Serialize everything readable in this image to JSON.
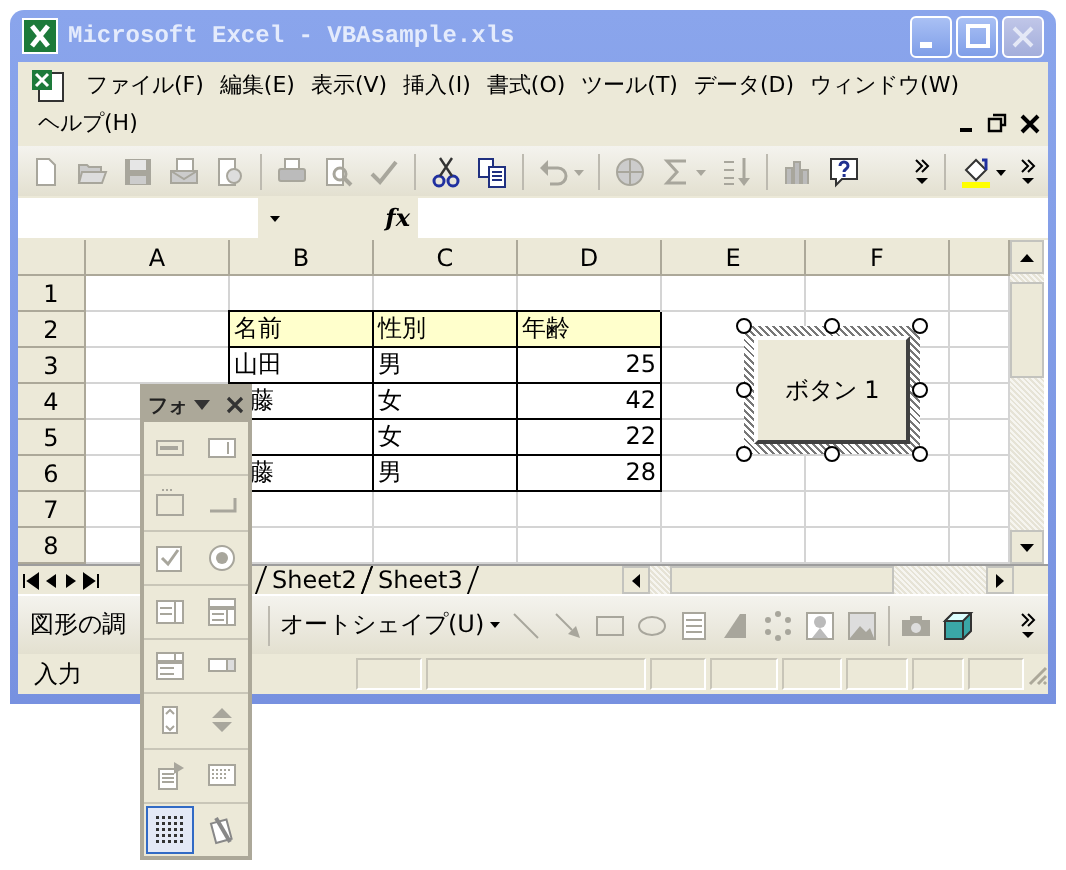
{
  "window": {
    "title": "Microsoft Excel - VBAsample.xls"
  },
  "menu_bar": {
    "items": [
      "ファイル(F)",
      "編集(E)",
      "表示(V)",
      "挿入(I)",
      "書式(O)",
      "ツール(T)",
      "データ(D)",
      "ウィンドウ(W)",
      "ヘルプ(H)"
    ]
  },
  "formula_bar": {
    "function_label": "fx"
  },
  "sheet": {
    "columns": [
      "A",
      "B",
      "C",
      "D",
      "E",
      "F"
    ],
    "rows": [
      {
        "header": "1"
      },
      {
        "header": "2",
        "cells": {
          "B": {
            "kind": "header",
            "text": "名前"
          },
          "C": {
            "kind": "header",
            "text": "性別"
          },
          "D": {
            "kind": "header",
            "text": "年齢"
          }
        }
      },
      {
        "header": "3",
        "cells": {
          "B": {
            "kind": "text",
            "text": "山田"
          },
          "C": {
            "kind": "text",
            "text": "男"
          },
          "D": {
            "kind": "number",
            "text": "25"
          }
        }
      },
      {
        "header": "4",
        "cells": {
          "B": {
            "kind": "text",
            "text": "藤"
          },
          "C": {
            "kind": "text",
            "text": "女"
          },
          "D": {
            "kind": "number",
            "text": "42"
          }
        }
      },
      {
        "header": "5",
        "cells": {
          "B": {
            "kind": "text"
          },
          "C": {
            "kind": "text",
            "text": "女"
          },
          "D": {
            "kind": "number",
            "text": "22"
          }
        }
      },
      {
        "header": "6",
        "cells": {
          "B": {
            "kind": "text",
            "text": "藤"
          },
          "C": {
            "kind": "text",
            "text": "男"
          },
          "D": {
            "kind": "number",
            "text": "28"
          }
        }
      },
      {
        "header": "7"
      },
      {
        "header": "8"
      }
    ]
  },
  "sheet_button": {
    "label": "ボタン 1",
    "selected": true
  },
  "sheet_tabs": [
    {
      "label": "Sheet2",
      "selected": false
    },
    {
      "label": "Sheet3",
      "selected": false
    }
  ],
  "drawing_toolbar": {
    "draw_menu": "図形の調",
    "autoshapes_menu": "オートシェイプ(U)"
  },
  "status_bar": {
    "text": "入力"
  },
  "forms_toolbar": {
    "title": "フォ",
    "tools": [
      {
        "kind": "label",
        "selected": false
      },
      {
        "kind": "edit-box",
        "selected": false
      },
      {
        "kind": "group-box",
        "selected": false
      },
      {
        "kind": "command-button",
        "selected": false
      },
      {
        "kind": "checkbox",
        "selected": false
      },
      {
        "kind": "option-button",
        "selected": false
      },
      {
        "kind": "list-box",
        "selected": false
      },
      {
        "kind": "combo-box",
        "selected": false
      },
      {
        "kind": "combo-list",
        "selected": false
      },
      {
        "kind": "combo-dropdown",
        "selected": false
      },
      {
        "kind": "scroll-bar",
        "selected": false
      },
      {
        "kind": "spinner",
        "selected": false
      },
      {
        "kind": "properties",
        "selected": false
      },
      {
        "kind": "code-window",
        "selected": false
      },
      {
        "kind": "grid",
        "selected": true
      },
      {
        "kind": "run-dialog",
        "selected": false
      }
    ]
  }
}
